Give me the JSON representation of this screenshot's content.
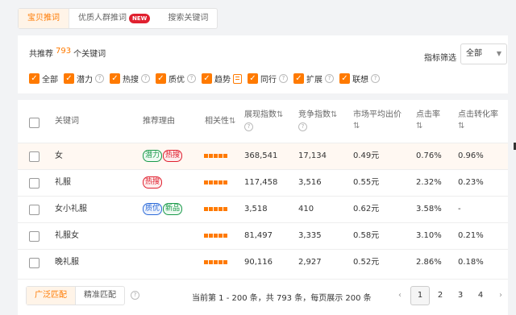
{
  "tabs": [
    {
      "label": "宝贝推词"
    },
    {
      "label": "优质人群推词",
      "badge": "NEW"
    },
    {
      "label": "搜索关键词"
    }
  ],
  "summary": {
    "prefix": "共推荐",
    "count": "793",
    "suffix": "个关键词"
  },
  "filter": {
    "label": "指标筛选",
    "value": "全部"
  },
  "checkboxes": [
    {
      "label": "全部"
    },
    {
      "label": "潜力"
    },
    {
      "label": "热搜"
    },
    {
      "label": "质优"
    },
    {
      "label": "趋势"
    },
    {
      "label": "同行"
    },
    {
      "label": "扩展"
    },
    {
      "label": "联想"
    }
  ],
  "columns": {
    "keyword": "关键词",
    "reason": "推荐理由",
    "relevance": "相关性",
    "impressions": "展现指数",
    "competition": "竞争指数",
    "avg_bid": "市场平均出价",
    "ctr": "点击率",
    "cvr": "点击转化率",
    "sort_icon": "⇅"
  },
  "rows": [
    {
      "keyword": "女",
      "tags": [
        "潜力",
        "热搜"
      ],
      "impressions": "368,541",
      "competition": "17,134",
      "avg_bid": "0.49元",
      "ctr": "0.76%",
      "cvr": "0.96%"
    },
    {
      "keyword": "礼服",
      "tags": [
        "热搜"
      ],
      "impressions": "117,458",
      "competition": "3,516",
      "avg_bid": "0.55元",
      "ctr": "2.32%",
      "cvr": "0.23%"
    },
    {
      "keyword": "女小礼服",
      "tags": [
        "质优",
        "新品"
      ],
      "impressions": "3,518",
      "competition": "410",
      "avg_bid": "0.62元",
      "ctr": "3.58%",
      "cvr": "-"
    },
    {
      "keyword": "礼服女",
      "tags": [],
      "impressions": "81,497",
      "competition": "3,335",
      "avg_bid": "0.58元",
      "ctr": "3.10%",
      "cvr": "0.21%"
    },
    {
      "keyword": "晚礼服",
      "tags": [],
      "impressions": "90,116",
      "competition": "2,927",
      "avg_bid": "0.52元",
      "ctr": "2.86%",
      "cvr": "0.18%"
    }
  ],
  "footer": {
    "match_broad": "广泛匹配",
    "match_exact": "精准匹配",
    "page_info": "当前第 1 - 200 条，共 793 条，每页展示 200 条",
    "pages": [
      "1",
      "2",
      "3",
      "4"
    ],
    "current_page": "1"
  },
  "colors": {
    "accent": "#ff7a00",
    "hot": "#e0202f",
    "green": "#1a9a4a",
    "blue": "#2d6bd8"
  }
}
